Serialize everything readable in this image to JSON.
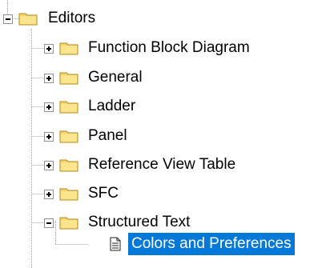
{
  "tree": {
    "root": {
      "label": "Editors",
      "icon": "folder-icon",
      "expanded": true
    },
    "children": [
      {
        "label": "Function Block Diagram",
        "icon": "folder-icon",
        "expanded": false
      },
      {
        "label": "General",
        "icon": "folder-icon",
        "expanded": false
      },
      {
        "label": "Ladder",
        "icon": "folder-icon",
        "expanded": false
      },
      {
        "label": "Panel",
        "icon": "folder-icon",
        "expanded": false
      },
      {
        "label": "Reference View Table",
        "icon": "folder-icon",
        "expanded": false
      },
      {
        "label": "SFC",
        "icon": "folder-icon",
        "expanded": false
      },
      {
        "label": "Structured Text",
        "icon": "folder-icon",
        "expanded": true,
        "children": [
          {
            "label": "Colors and Preferences",
            "icon": "document-icon",
            "selected": true
          }
        ]
      }
    ]
  },
  "colors": {
    "selection_bg": "#0078d7",
    "selection_fg": "#ffffff",
    "folder_fill": "#f6d46a",
    "folder_edge": "#b08a1e",
    "tree_line": "#a0a0a0"
  }
}
